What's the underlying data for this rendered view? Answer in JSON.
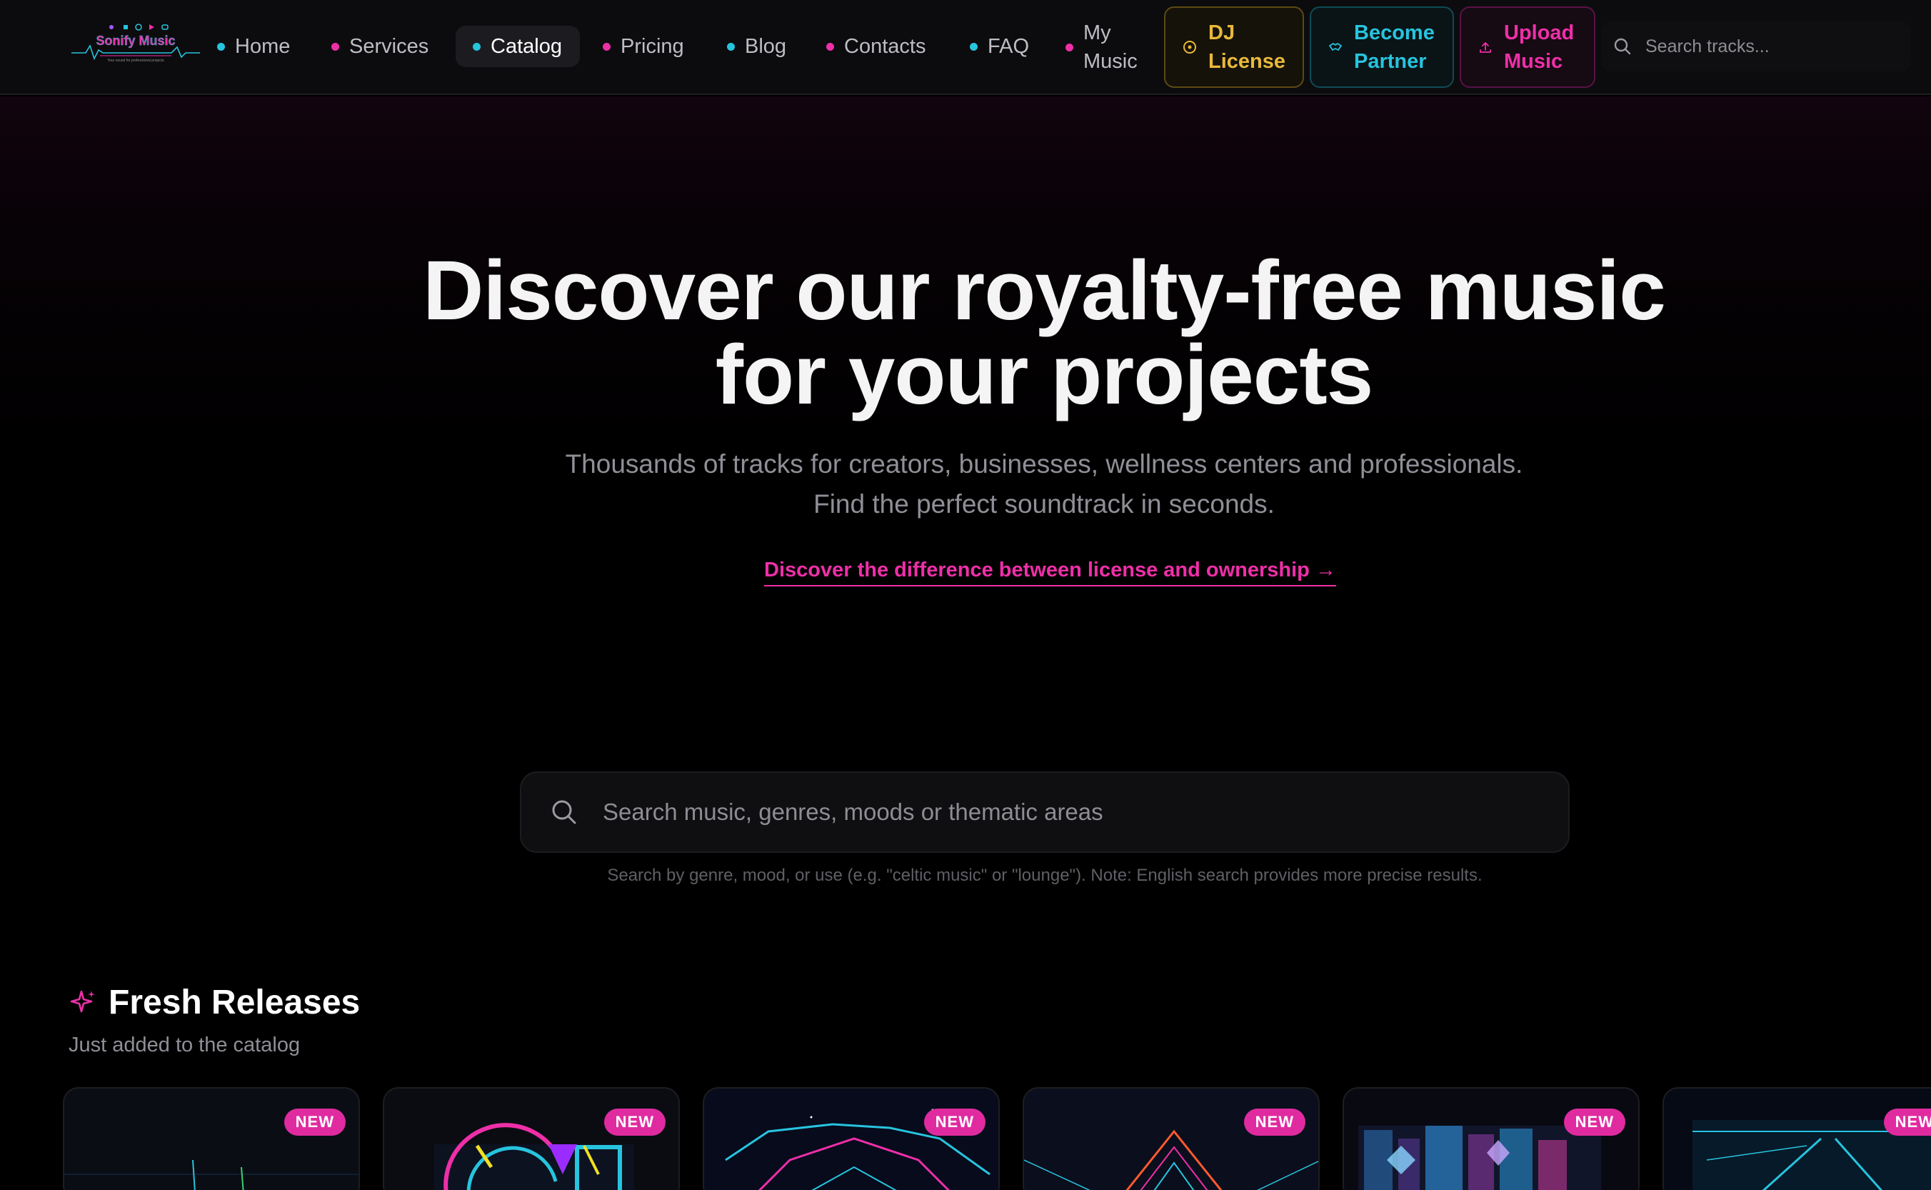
{
  "brand": {
    "name": "Sonify Music",
    "tagline": "Your sound for professional projects",
    "colors": {
      "accent_pink": "#ee2fa8",
      "accent_cyan": "#27c4de",
      "accent_gold": "#e8b93a",
      "background": "#000000"
    }
  },
  "nav": {
    "items": [
      {
        "label": "Home",
        "dot_color": "#27c4de",
        "active": false
      },
      {
        "label": "Services",
        "dot_color": "#ee2fa8",
        "active": false
      },
      {
        "label": "Catalog",
        "dot_color": "#27c4de",
        "active": true
      },
      {
        "label": "Pricing",
        "dot_color": "#ee2fa8",
        "active": false
      },
      {
        "label": "Blog",
        "dot_color": "#27c4de",
        "active": false
      },
      {
        "label": "Contacts",
        "dot_color": "#ee2fa8",
        "active": false
      },
      {
        "label": "FAQ",
        "dot_color": "#27c4de",
        "active": false
      },
      {
        "label": "My Music",
        "dot_color": "#ee2fa8",
        "active": false
      }
    ],
    "cta": {
      "dj_license": {
        "label": "DJ License",
        "icon": "vinyl-icon"
      },
      "become_partner": {
        "label": "Become Partner",
        "icon": "handshake-icon"
      },
      "upload_music": {
        "label": "Upload Music",
        "icon": "upload-icon"
      }
    },
    "search_placeholder": "Search tracks..."
  },
  "hero": {
    "title": "Discover our royalty-free music for your projects",
    "subtitle": "Thousands of tracks for creators, businesses, wellness centers and professionals. Find the perfect soundtrack in seconds.",
    "link": "Discover the difference between license and ownership →"
  },
  "main_search": {
    "placeholder": "Search music, genres, moods or thematic areas",
    "hint": "Search by genre, mood, or use (e.g. \"celtic music\" or \"lounge\"). Note: English search provides more precise results."
  },
  "fresh_releases": {
    "title": "Fresh Releases",
    "subtitle": "Just added to the catalog",
    "badge": "NEW",
    "cards": [
      {
        "art": "neon-city-grid"
      },
      {
        "art": "neon-geometric-shapes"
      },
      {
        "art": "neon-triangle-lights"
      },
      {
        "art": "neon-mountain-peaks"
      },
      {
        "art": "neon-city-skyline"
      },
      {
        "art": "neon-tunnel"
      }
    ]
  }
}
